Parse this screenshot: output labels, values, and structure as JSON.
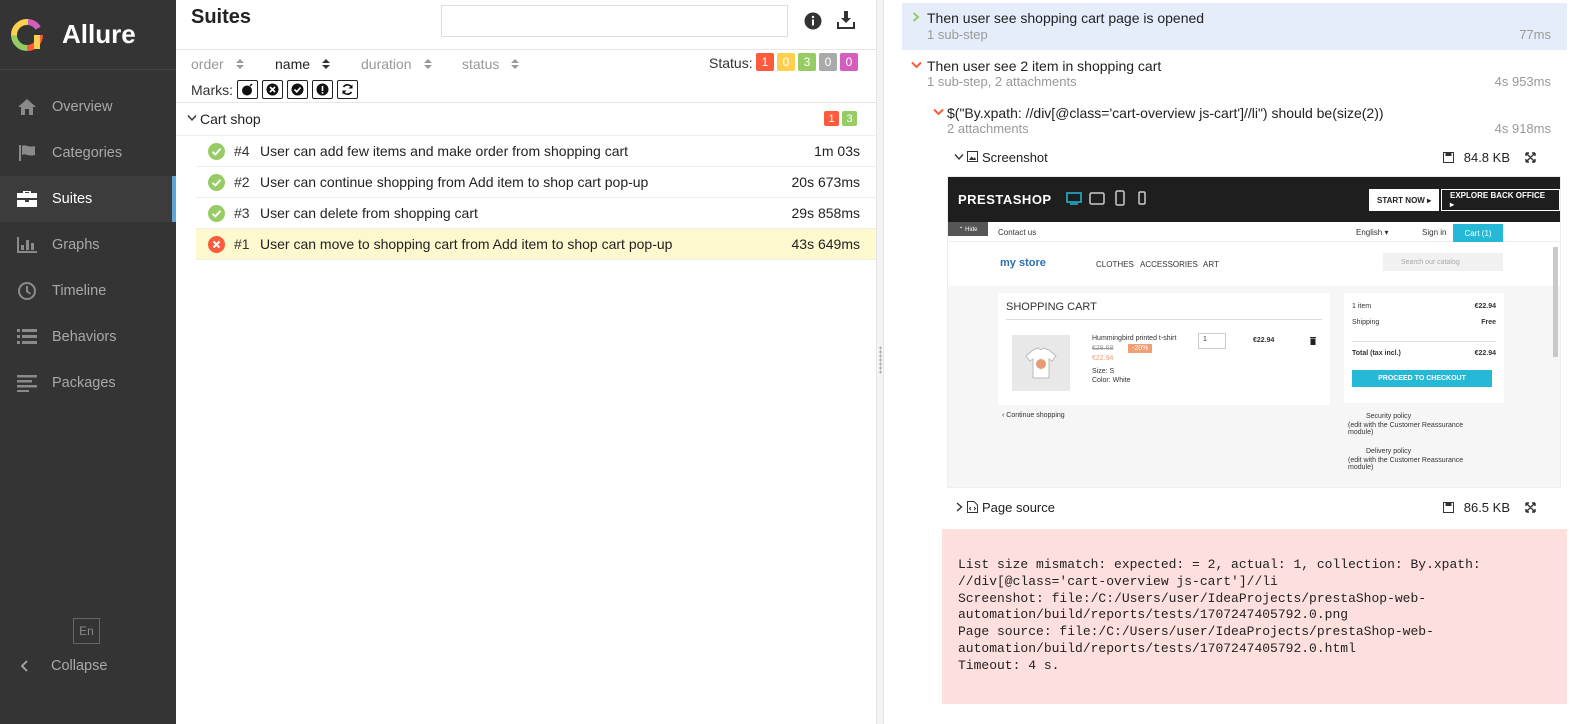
{
  "app": {
    "name": "Allure"
  },
  "sidebar": {
    "items": [
      {
        "label": "Overview",
        "icon": "home-icon"
      },
      {
        "label": "Categories",
        "icon": "flag-icon"
      },
      {
        "label": "Suites",
        "icon": "briefcase-icon"
      },
      {
        "label": "Graphs",
        "icon": "bar-chart-icon"
      },
      {
        "label": "Timeline",
        "icon": "clock-icon"
      },
      {
        "label": "Behaviors",
        "icon": "list-icon"
      },
      {
        "label": "Packages",
        "icon": "align-left-icon"
      }
    ],
    "active": "Suites",
    "language": "En",
    "collapse_label": "Collapse"
  },
  "suites": {
    "title": "Suites",
    "search": {
      "value": "",
      "placeholder": ""
    },
    "sort": {
      "order": "order",
      "name": "name",
      "duration": "duration",
      "status": "status"
    },
    "status_label": "Status:",
    "status_counts": [
      {
        "value": "1",
        "color": "#fd5a3e"
      },
      {
        "value": "0",
        "color": "#ffd050"
      },
      {
        "value": "3",
        "color": "#97cc64"
      },
      {
        "value": "0",
        "color": "#aaaaaa"
      },
      {
        "value": "0",
        "color": "#d35ebe"
      }
    ],
    "marks_label": "Marks:",
    "group": {
      "name": "Cart shop",
      "failed": "1",
      "passed": "3"
    },
    "tests": [
      {
        "num": "#4",
        "name": "User can add few items and make order from shopping cart",
        "duration": "1m 03s",
        "status": "passed"
      },
      {
        "num": "#2",
        "name": "User can continue shopping from Add item to shop cart pop-up",
        "duration": "20s 673ms",
        "status": "passed"
      },
      {
        "num": "#3",
        "name": "User can delete from shopping cart",
        "duration": "29s 858ms",
        "status": "passed"
      },
      {
        "num": "#1",
        "name": "User can move to shopping cart from Add item to shop cart pop-up",
        "duration": "43s 649ms",
        "status": "failed"
      }
    ]
  },
  "details": {
    "steps": [
      {
        "title": "Then user see shopping cart page is opened",
        "sub": "1 sub-step",
        "duration": "77ms"
      },
      {
        "title": "Then user see 2 item in shopping cart",
        "sub": "1 sub-step, 2 attachments",
        "duration": "4s 953ms"
      },
      {
        "title": "$(\"By.xpath: //div[@class='cart-overview js-cart']//li\") should be(size(2))",
        "sub": "2 attachments",
        "duration": "4s 918ms"
      }
    ],
    "attachments": [
      {
        "name": "Screenshot",
        "size": "84.8 KB"
      },
      {
        "name": "Page source",
        "size": "86.5 KB"
      }
    ],
    "error": "List size mismatch: expected: = 2, actual: 1, collection: By.xpath:\n//div[@class='cart-overview js-cart']//li\nScreenshot: file:/C:/Users/user/IdeaProjects/prestaShop-web-\nautomation/build/reports/tests/1707247405792.0.png\nPage source: file:/C:/Users/user/IdeaProjects/prestaShop-web-\nautomation/build/reports/tests/1707247405792.0.html\nTimeout: 4 s."
  },
  "screenshot": {
    "logo": "PRESTASHOP",
    "start_now": "START NOW ▸",
    "explore": "EXPLORE BACK OFFICE ▸",
    "hide": "⌃ Hide",
    "contact": "Contact us",
    "english": "English ▾",
    "sign_in": "Sign in",
    "cart": "Cart (1)",
    "brand": "my store",
    "menu": [
      "CLOTHES",
      "ACCESSORIES",
      "ART"
    ],
    "search_placeholder": "Search our catalog",
    "cart_title": "SHOPPING CART",
    "product": "Hummingbird printed t-shirt",
    "old_price": "€28.68",
    "discount": "-20%",
    "price": "€22.94",
    "size": "Size: S",
    "color": "Color: White",
    "qty": "1",
    "line_total": "€22.94",
    "items_label": "1 item",
    "items_value": "€22.94",
    "shipping_label": "Shipping",
    "shipping_value": "Free",
    "total_label": "Total (tax incl.)",
    "total_value": "€22.94",
    "checkout": "PROCEED TO CHECKOUT",
    "continue": "‹ Continue shopping",
    "security": "Security policy",
    "security_sub": "(edit with the Customer Reassurance module)",
    "delivery": "Delivery policy",
    "delivery_sub": "(edit with the Customer Reassurance module)"
  }
}
